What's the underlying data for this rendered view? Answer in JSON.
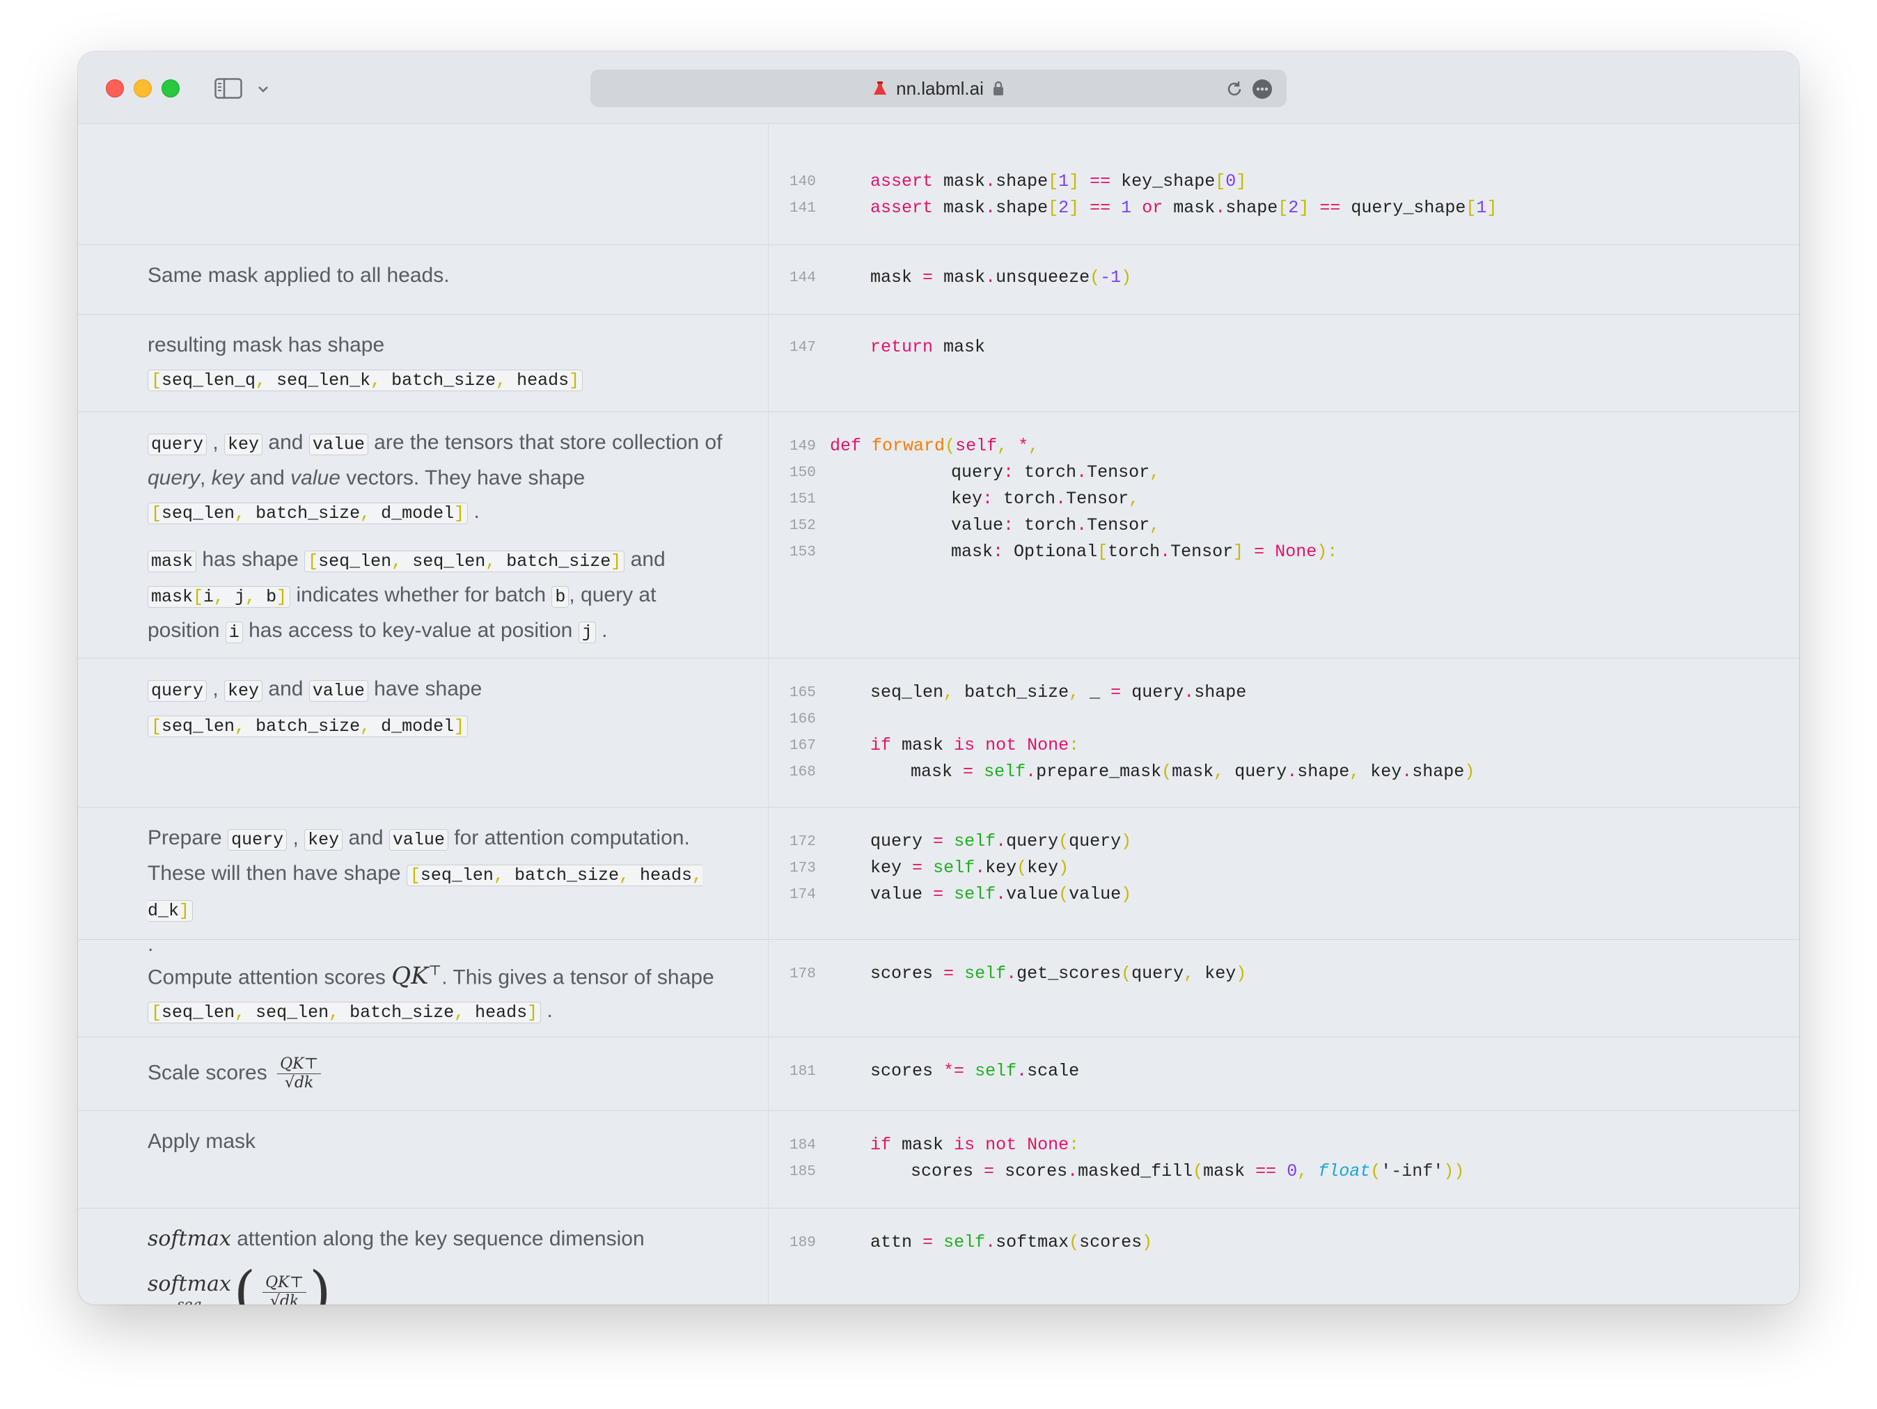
{
  "browser": {
    "url": "nn.labml.ai",
    "colors": {
      "close": "#fe5f57",
      "minimize": "#febc2e",
      "zoom": "#28c840"
    }
  },
  "docs": {
    "s2": "Same mask applied to all heads.",
    "s3_line1": "resulting mask has shape",
    "s3_code": [
      "seq_len_q",
      "seq_len_k",
      "batch_size",
      "heads"
    ],
    "s4_p1": {
      "query": "query",
      "sep1": ",",
      "key": "key",
      "and1": "and",
      "value": "value",
      "text1": "are the tensors that store collection of",
      "i_query": "query",
      "sep2": ",",
      "i_key": "key",
      "and2": "and",
      "i_value": "value",
      "text2": "vectors. They have shape",
      "shape": [
        "seq_len",
        "batch_size",
        "d_model"
      ],
      "period": "."
    },
    "s4_p2": {
      "mask": "mask",
      "t1": "has shape",
      "shape": [
        "seq_len",
        "seq_len",
        "batch_size"
      ],
      "t2": "and",
      "mask2": "mask",
      "idx": [
        "i",
        "j",
        "b"
      ],
      "t3": "indicates whether for batch",
      "b": "b",
      "t4": ", query at",
      "t5": "position",
      "i": "i",
      "t6": "has access to key-value at position",
      "j": "j",
      "t7": "."
    },
    "s5": {
      "query": "query",
      "sep1": ",",
      "key": "key",
      "and1": "and",
      "value": "value",
      "t1": "have shape",
      "shape": [
        "seq_len",
        "batch_size",
        "d_model"
      ]
    },
    "s6": {
      "t1": "Prepare",
      "query": "query",
      "sep1": ",",
      "key": "key",
      "and1": "and",
      "value": "value",
      "t2": "for attention computation.",
      "t3": "These will then have shape",
      "shape": [
        "seq_len",
        "batch_size",
        "heads",
        "d_k"
      ],
      "period": "."
    },
    "s7": {
      "t1": "Compute attention scores",
      "qk": "QK",
      "top": "⊤",
      "t2": ". This gives a tensor of shape",
      "shape": [
        "seq_len",
        "seq_len",
        "batch_size",
        "heads"
      ],
      "period": "."
    },
    "s8": {
      "t1": "Scale scores",
      "num": "QK⊤",
      "den": "√dk"
    },
    "s9": "Apply mask",
    "s10": {
      "softmax": "softmax",
      "t1": "attention along the key sequence dimension",
      "seq": "seq",
      "num": "QK⊤",
      "den": "√dk"
    }
  },
  "code": {
    "lines": {
      "140": "140",
      "141": "141",
      "144": "144",
      "147": "147",
      "149": "149",
      "150": "150",
      "151": "151",
      "152": "152",
      "153": "153",
      "165": "165",
      "166": "166",
      "167": "167",
      "168": "168",
      "172": "172",
      "173": "173",
      "174": "174",
      "178": "178",
      "181": "181",
      "184": "184",
      "185": "185",
      "189": "189"
    },
    "t": {
      "assert": "assert",
      "mask": "mask",
      "dot": ".",
      "shape": "shape",
      "lb": "[",
      "rb": "]",
      "eq": "==",
      "one": "1",
      "zero": "0",
      "two": "2",
      "key_shape": "key_shape",
      "query_shape": "query_shape",
      "or": "or",
      "assign": "=",
      "unsqueeze": "unsqueeze",
      "lp": "(",
      "rp": ")",
      "neg1": "-1",
      "return": "return",
      "def": "def",
      "forward": "forward",
      "self": "self",
      "comma": ",",
      "star": "*",
      "query": "query",
      "key": "key",
      "value": "value",
      "colon": ":",
      "torch": "torch",
      "Tensor": "Tensor",
      "Optional": "Optional",
      "None": "None",
      "rpc": "):",
      "seq_len": "seq_len",
      "batch_size": "batch_size",
      "under": "_",
      "if": "if",
      "is": "is",
      "not": "not",
      "prepare_mask": "prepare_mask",
      "scores": "scores",
      "get_scores": "get_scores",
      "muleq": "*=",
      "scale": "scale",
      "masked_fill": "masked_fill",
      "float": "float",
      "ninf": "'-inf'",
      "attn": "attn",
      "softmax": "softmax"
    }
  }
}
